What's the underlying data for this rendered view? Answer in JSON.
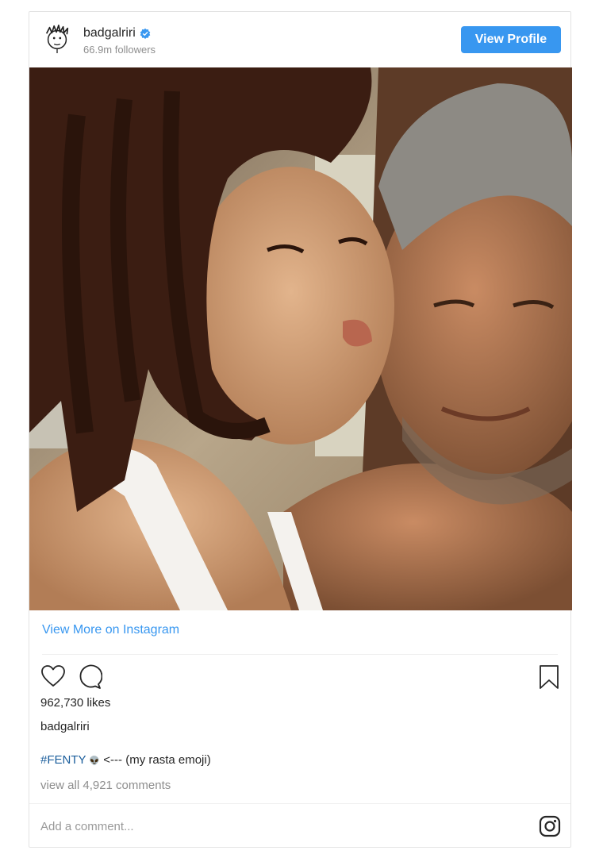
{
  "post": {
    "username": "badgalriri",
    "followers": "66.9m followers",
    "view_profile_label": "View Profile",
    "view_more_label": "View More on Instagram",
    "likes": "962,730 likes",
    "caption_owner": "badgalriri",
    "caption_hashtag": "#FENTY",
    "caption_emoji": "👽",
    "caption_text": "<--- (my rasta emoji)",
    "view_all_comments": "view all 4,921 comments",
    "comment_placeholder": "Add a comment..."
  },
  "icons": {
    "verified": "verified-badge-icon",
    "like": "heart-icon",
    "comment": "comment-bubble-icon",
    "save": "bookmark-icon",
    "instagram": "instagram-logo-icon"
  },
  "colors": {
    "accent": "#3897f0",
    "hashtag": "#1b5e9c",
    "muted": "#8e8e8e"
  }
}
